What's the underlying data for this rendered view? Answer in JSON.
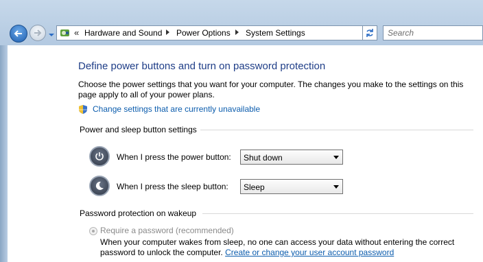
{
  "address_bar": {
    "crumb_prefix": "«",
    "crumbs": [
      "Hardware and Sound",
      "Power Options",
      "System Settings"
    ]
  },
  "search": {
    "placeholder": "Search"
  },
  "page": {
    "title": "Define power buttons and turn on password protection",
    "intro_line1": "Choose the power settings that you want for your computer. The changes you make to the settings on this",
    "intro_line2": "page apply to all of your power plans.",
    "change_settings_link": "Change settings that are currently unavailable"
  },
  "power_sleep": {
    "heading": "Power and sleep button settings",
    "power_label": "When I press the power button:",
    "power_value": "Shut down",
    "sleep_label": "When I press the sleep button:",
    "sleep_value": "Sleep"
  },
  "password": {
    "heading": "Password protection on wakeup",
    "require_label": "Require a password (recommended)",
    "desc_line1": "When your computer wakes from sleep, no one can access your data without entering the correct",
    "desc_line2_prefix": "password to unlock the computer.",
    "account_link": "Create or change your user account password"
  },
  "colors": {
    "title": "#1e3d87",
    "link": "#0b5cad",
    "chrome": "#b3c9e1"
  },
  "icons": [
    "back-arrow-icon",
    "forward-arrow-icon",
    "control-panel-icon",
    "refresh-icon",
    "shield-icon",
    "power-button-icon",
    "sleep-button-icon"
  ]
}
